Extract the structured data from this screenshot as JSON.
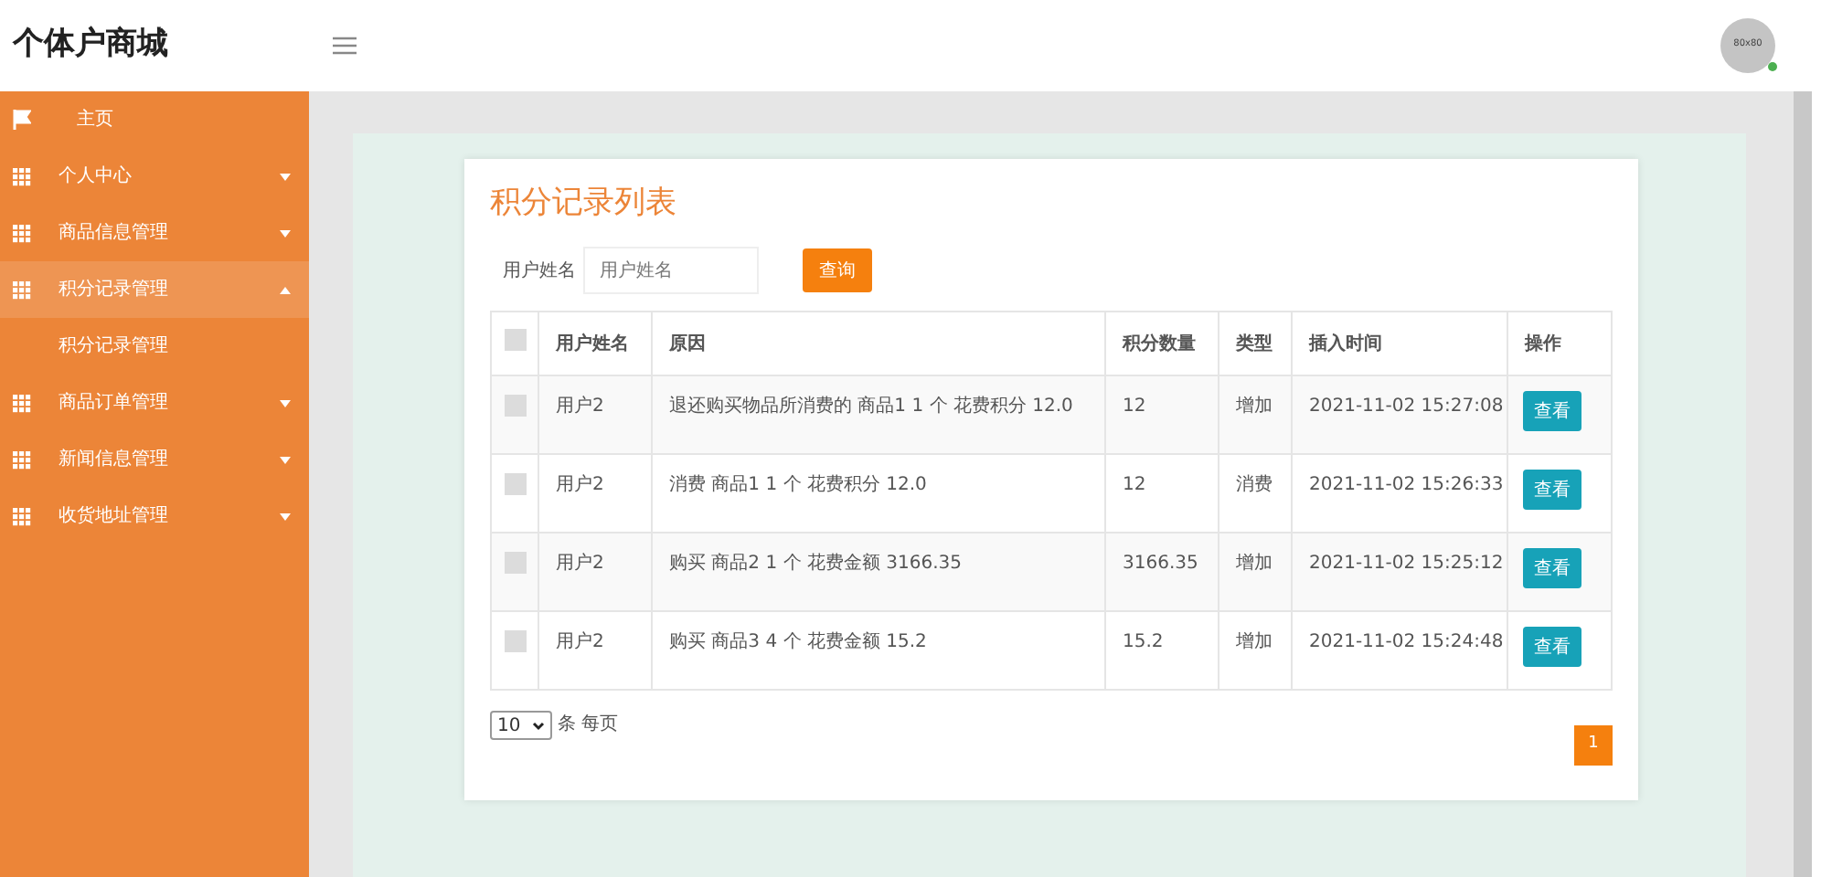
{
  "header": {
    "title": "个体户商城",
    "avatar": {
      "label": "80x80",
      "online": true
    }
  },
  "sidebar": {
    "items": [
      {
        "label": "主页",
        "kind": "flag",
        "selected": false
      },
      {
        "label": "个人中心",
        "kind": "grid",
        "expandable": true,
        "expanded": false,
        "selected": false
      },
      {
        "label": "商品信息管理",
        "kind": "grid",
        "expandable": true,
        "expanded": false,
        "selected": false
      },
      {
        "label": "积分记录管理",
        "kind": "grid",
        "expandable": true,
        "expanded": true,
        "selected": true,
        "children": [
          {
            "label": "积分记录管理"
          }
        ]
      },
      {
        "label": "商品订单管理",
        "kind": "grid",
        "expandable": true,
        "expanded": false,
        "selected": false
      },
      {
        "label": "新闻信息管理",
        "kind": "grid",
        "expandable": true,
        "expanded": false,
        "selected": false
      },
      {
        "label": "收货地址管理",
        "kind": "grid",
        "expandable": true,
        "expanded": false,
        "selected": false
      }
    ]
  },
  "card": {
    "title": "积分记录列表",
    "search": {
      "label": "用户姓名",
      "placeholder": "用户姓名",
      "button": "查询"
    },
    "table": {
      "select_all_checked": false,
      "columns": [
        "用户姓名",
        "原因",
        "积分数量",
        "类型",
        "插入时间",
        "操作"
      ],
      "rows": [
        {
          "checked": false,
          "user": "用户2",
          "reason": "退还购买物品所消费的 商品1 1 个 花费积分 12.0",
          "amount": "12",
          "type": "增加",
          "time": "2021-11-02 15:27:08",
          "action": "查看"
        },
        {
          "checked": false,
          "user": "用户2",
          "reason": "消费 商品1 1 个 花费积分 12.0",
          "amount": "12",
          "type": "消费",
          "time": "2021-11-02 15:26:33",
          "action": "查看"
        },
        {
          "checked": false,
          "user": "用户2",
          "reason": "购买 商品2 1 个 花费金额 3166.35",
          "amount": "3166.35",
          "type": "增加",
          "time": "2021-11-02 15:25:12",
          "action": "查看"
        },
        {
          "checked": false,
          "user": "用户2",
          "reason": "购买 商品3 4 个 花费金额 15.2",
          "amount": "15.2",
          "type": "增加",
          "time": "2021-11-02 15:24:48",
          "action": "查看"
        }
      ]
    },
    "page_size": {
      "value": "10",
      "label": "条 每页"
    },
    "pages": [
      {
        "label": "1",
        "selected": true
      }
    ]
  }
}
